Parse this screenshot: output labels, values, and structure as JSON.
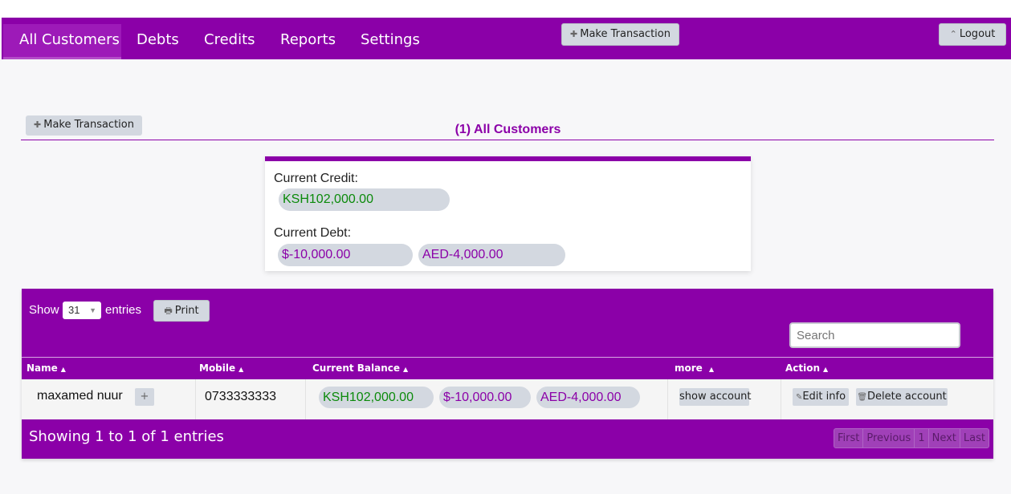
{
  "nav": {
    "tabs": [
      "All Customers",
      "Debts",
      "Credits",
      "Reports",
      "Settings"
    ],
    "make_transaction": "Make Transaction",
    "logout": "Logout"
  },
  "toolbar": {
    "make_transaction": "Make Transaction"
  },
  "page_title": "(1) All Customers",
  "summary": {
    "credit_label": "Current Credit:",
    "credits": [
      "KSH102,000.00"
    ],
    "debt_label": "Current Debt:",
    "debts": [
      "$-10,000.00",
      "AED-4,000.00"
    ]
  },
  "table": {
    "show_label": "Show",
    "entries_value": "31",
    "entries_label": "entries",
    "print_label": "Print",
    "search_placeholder": "Search",
    "columns": [
      "Name",
      "Mobile",
      "Current Balance",
      "more",
      "Action"
    ],
    "rows": [
      {
        "name": "maxamed nuur",
        "add": "+",
        "mobile": "0733333333",
        "balances": [
          "KSH102,000.00",
          "$-10,000.00",
          "AED-4,000.00"
        ],
        "more": "show account",
        "edit": "Edit info",
        "delete": "Delete account"
      }
    ],
    "info": "Showing 1 to 1 of 1 entries",
    "pagination": [
      "First",
      "Previous",
      "1",
      "Next",
      "Last"
    ]
  },
  "colors": {
    "brand": "#8b00a8",
    "credit": "#0b8a0b",
    "debt": "#8b00a8",
    "pill_bg": "#d3d8e0"
  }
}
